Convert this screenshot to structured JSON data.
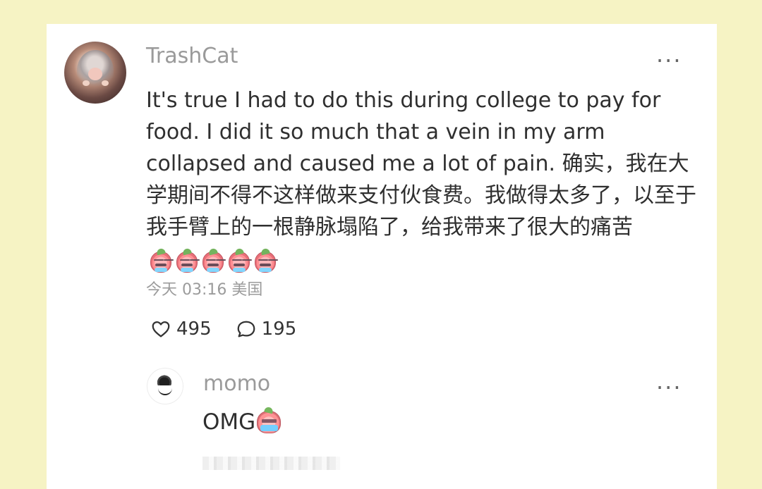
{
  "comment": {
    "username": "TrashCat",
    "body": "It's true I had to do this during college to pay for food. I did it so much that a vein in my arm collapsed and caused me a lot of pain. 确实，我在大学期间不得不这样做来支付伙食费。我做得太多了，以至于我手臂上的一根静脉塌陷了，给我带来了很大的痛苦",
    "emoji_icons": [
      "peach-sweat-emoji-icon",
      "peach-sweat-emoji-icon",
      "peach-sweat-emoji-icon",
      "peach-sweat-emoji-icon",
      "peach-sweat-emoji-icon"
    ],
    "time_location": "今天 03:16 美国",
    "like_count": "495",
    "reply_count": "195",
    "more_label": "···"
  },
  "reply": {
    "username": "momo",
    "text": "OMG",
    "emoji_icon": "peach-crying-emoji-icon",
    "more_label": "···"
  },
  "colors": {
    "page_background": "#f6f3c4",
    "card_background": "#ffffff",
    "muted_text": "#9a9a9a",
    "body_text": "#2f2f2f"
  }
}
